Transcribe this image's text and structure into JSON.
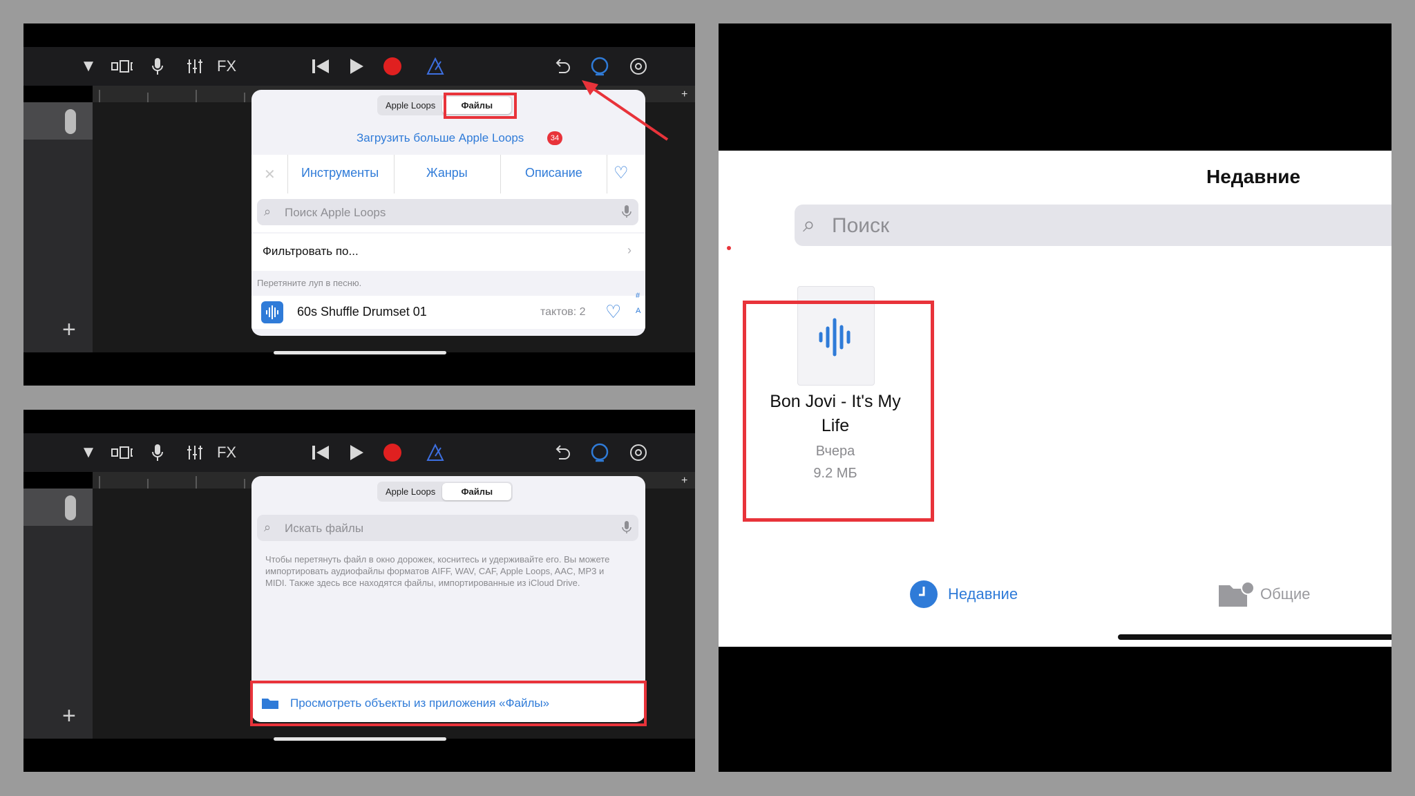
{
  "toolbar": {
    "icons": [
      "chevron-down-icon",
      "view-icon",
      "mic-icon",
      "mixer-icon",
      "fx-icon",
      "rewind-icon",
      "play-icon",
      "record-icon",
      "metronome-icon",
      "undo-icon",
      "loops-icon",
      "settings-icon"
    ],
    "fx_label": "FX"
  },
  "popover_top": {
    "tabs": [
      "Apple Loops",
      "Файлы"
    ],
    "selected_tab": "Файлы",
    "download_link": "Загрузить больше Apple Loops",
    "download_badge": "34",
    "filters": [
      "Инструменты",
      "Жанры",
      "Описание"
    ],
    "search_placeholder": "Поиск Apple Loops",
    "filter_by": "Фильтровать по...",
    "hint": "Перетяните луп в песню.",
    "loop_item": {
      "name": "60s Shuffle Drumset 01",
      "bars": "тактов: 2"
    },
    "index_letters": [
      "#",
      "A"
    ]
  },
  "popover_bottom": {
    "tabs": [
      "Apple Loops",
      "Файлы"
    ],
    "selected_tab": "Файлы",
    "search_placeholder": "Искать файлы",
    "description": "Чтобы перетянуть файл в окно дорожек, коснитесь и удерживайте его. Вы можете импортировать аудиофайлы форматов AIFF, WAV, CAF, Apple Loops, AAC, MP3 и MIDI. Также здесь все находятся файлы, импортированные из iCloud Drive.",
    "browse_button": "Просмотреть объекты из приложения «Файлы»"
  },
  "files_panel": {
    "title": "Недавние",
    "search_placeholder": "Поиск",
    "file": {
      "name": "Bon Jovi - It's My Life",
      "date": "Вчера",
      "size": "9.2 МБ"
    },
    "tabs": [
      {
        "label": "Недавние",
        "active": true
      },
      {
        "label": "Общие",
        "active": false
      }
    ]
  },
  "colors": {
    "accent": "#2f7bd8",
    "highlight": "#e8333a",
    "record": "#e02020"
  }
}
